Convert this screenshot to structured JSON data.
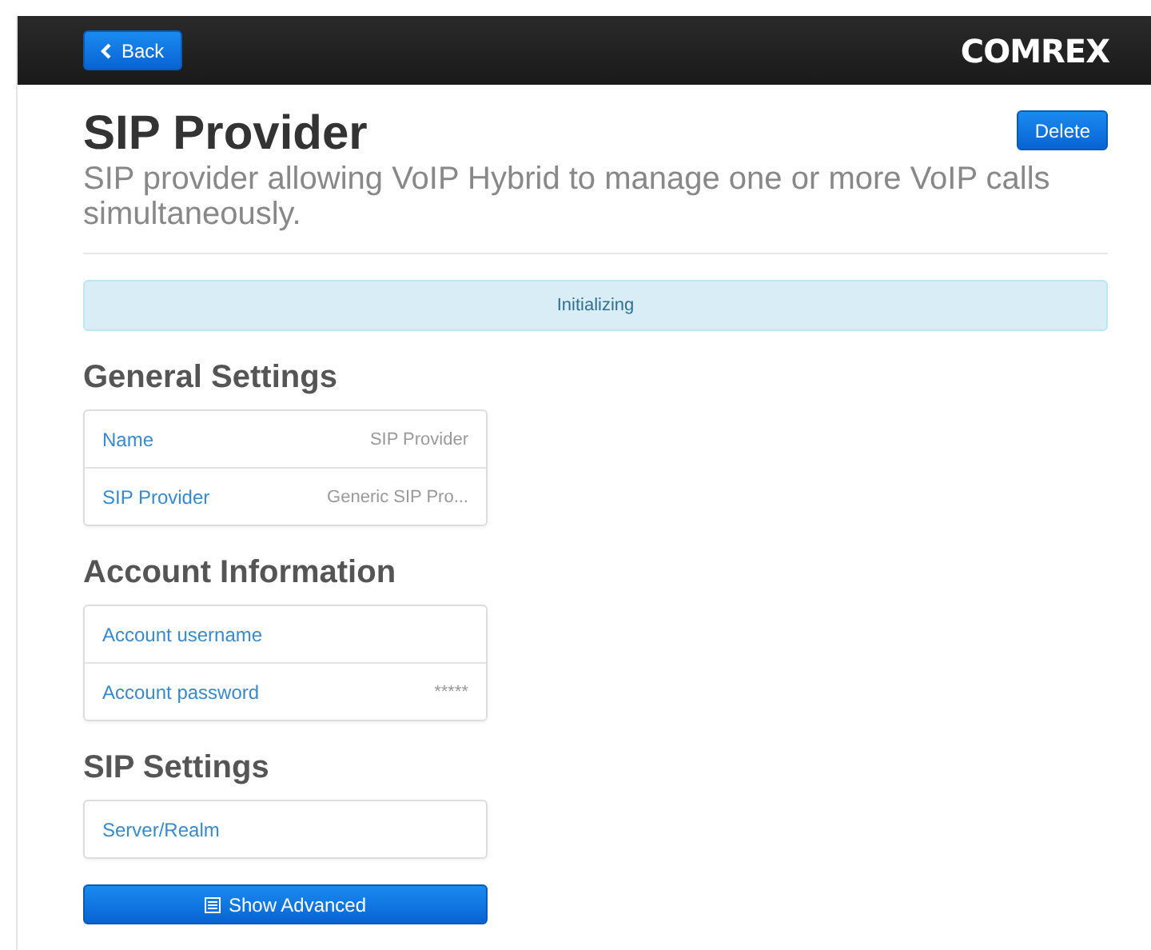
{
  "header": {
    "back_button": "Back",
    "logo": "COMREX"
  },
  "page": {
    "title": "SIP Provider",
    "delete_button": "Delete",
    "subtitle": "SIP provider allowing VoIP Hybrid to manage one or more VoIP calls simultaneously."
  },
  "status": "Initializing",
  "sections": [
    {
      "title": "General Settings",
      "rows": [
        {
          "label": "Name",
          "value": "SIP Provider"
        },
        {
          "label": "SIP Provider",
          "value": "Generic SIP Pro..."
        }
      ]
    },
    {
      "title": "Account Information",
      "rows": [
        {
          "label": "Account username"
        },
        {
          "label": "Account password",
          "value": "*****"
        }
      ]
    },
    {
      "title": "SIP Settings",
      "rows": [
        {
          "label": "Server/Realm"
        }
      ]
    }
  ],
  "advanced_button": "Show Advanced"
}
